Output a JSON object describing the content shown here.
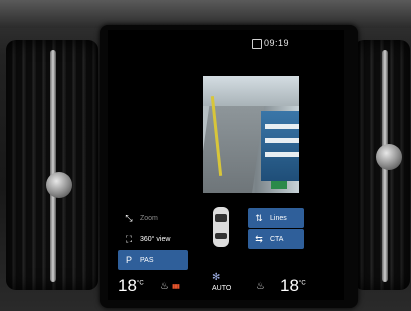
{
  "status_bar": {
    "time": "09:19"
  },
  "park_assist": {
    "buttons": {
      "zoom": {
        "label": "Zoom",
        "icon": "zoom-icon",
        "active": false
      },
      "view_360": {
        "label": "360° view",
        "icon": "camera-360-icon",
        "active": false
      },
      "pas": {
        "label": "PAS",
        "icon": "parking-assist-icon",
        "active": true
      },
      "lines": {
        "label": "Lines",
        "icon": "guide-lines-icon",
        "active": true
      },
      "cta": {
        "label": "CTA",
        "icon": "cross-traffic-icon",
        "active": true
      }
    }
  },
  "climate": {
    "left_temp": "18",
    "left_unit": "°C",
    "right_temp": "18",
    "right_unit": "°C",
    "fan_mode": "AUTO"
  },
  "colors": {
    "accent_blue": "#2f5f9a",
    "seat_heat": "#e5542c"
  }
}
